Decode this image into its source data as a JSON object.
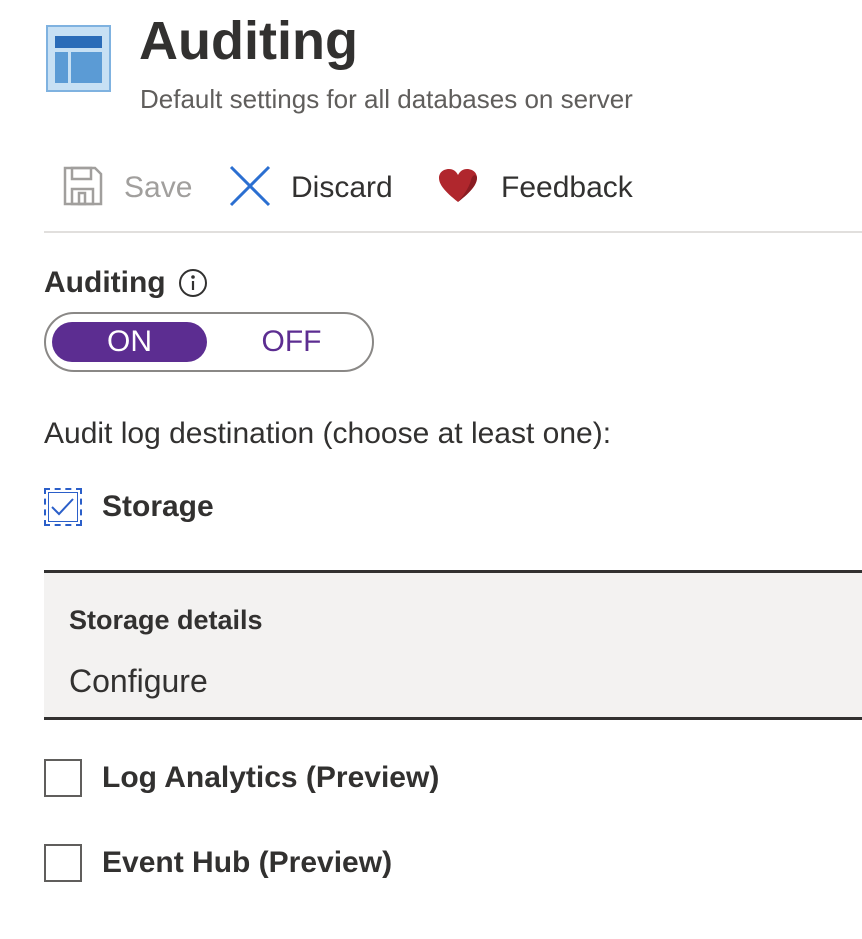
{
  "header": {
    "title": "Auditing",
    "subtitle": "Default settings for all databases on server",
    "icon": "table-icon"
  },
  "toolbar": {
    "save_label": "Save",
    "save_enabled": false,
    "discard_label": "Discard",
    "feedback_label": "Feedback"
  },
  "auditing": {
    "label": "Auditing",
    "toggle": {
      "on_label": "ON",
      "off_label": "OFF",
      "selected": "ON"
    }
  },
  "destination": {
    "label": "Audit log destination (choose at least one):",
    "options": [
      {
        "label": "Storage",
        "checked": true
      },
      {
        "label": "Log Analytics (Preview)",
        "checked": false
      },
      {
        "label": "Event Hub (Preview)",
        "checked": false
      }
    ]
  },
  "storage_details": {
    "title": "Storage details",
    "link": "Configure"
  },
  "colors": {
    "accent_purple": "#5c2d91",
    "checkbox_blue": "#2b5fc9",
    "heart_red": "#b0272d",
    "discard_blue": "#2b6fd1",
    "panel_bg": "#f3f2f1"
  }
}
